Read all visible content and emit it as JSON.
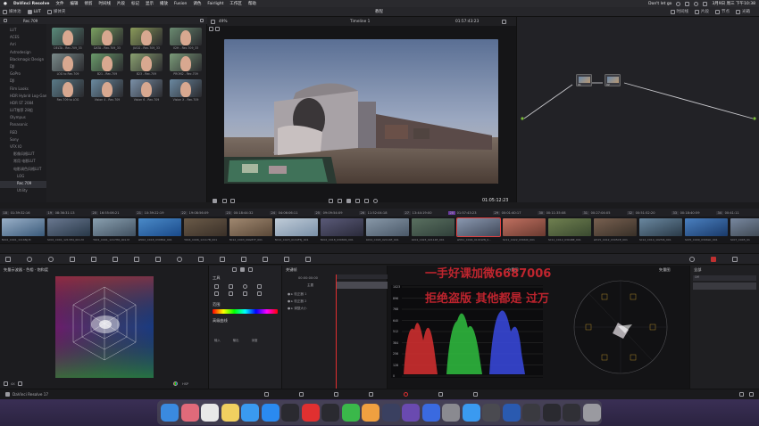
{
  "menubar": {
    "app": "DaVinci Resolve",
    "items": [
      "文件",
      "编辑",
      "修剪",
      "时间线",
      "片段",
      "标记",
      "显示",
      "播放",
      "Fusion",
      "调色",
      "Fairlight",
      "工作区",
      "帮助"
    ],
    "now_playing": "Don't let go",
    "datetime": "3月9日 周三 下午10:38"
  },
  "toolbar": {
    "left": [
      "媒体池",
      "LUT",
      "媒体夹"
    ],
    "project_title": "教程",
    "right": [
      "时间线",
      "片段",
      "节点",
      "光箱"
    ],
    "lightbox": "光箱"
  },
  "lut_panel": {
    "current_folder": "Rec.709",
    "tree": [
      "LUT",
      "ACES",
      "Arri",
      "Astrodesign",
      "Blackmagic Design",
      "DJI",
      "GoPro",
      "DJI",
      "Film Looks",
      "HDR Hybrid Log-Gamma",
      "HDR ST 2084",
      "LUT推荐 28组",
      "Olympus",
      "Panasonic",
      "RED",
      "Sony",
      "VFX IO",
      "影像风格LUT",
      "常用 电影LUT",
      "电影调色风格LUT",
      "LOG",
      "Rec.709",
      "Utility"
    ],
    "selected_tree": "Rec.709",
    "luts": [
      {
        "label": "DELTA - Rec.709_33",
        "tint": "#5a8a7a"
      },
      {
        "label": "DATA - Rec.709_33",
        "tint": "#7aa060"
      },
      {
        "label": "JUGG - Rec.709_33",
        "tint": "#8a9a5a"
      },
      {
        "label": "V2H - Rec.709_33",
        "tint": "#6a8a70"
      },
      {
        "label": "LOG to Rec.709",
        "tint": "#7a8a8a"
      },
      {
        "label": "B21 - Rec.709",
        "tint": "#6a9a6a"
      },
      {
        "label": "B23 - Rec.709",
        "tint": "#8aa070"
      },
      {
        "label": "PROM2 - Rec.709",
        "tint": "#7a9a78"
      },
      {
        "label": "Rec.709 to LOG",
        "tint": "#5a7a88"
      },
      {
        "label": "Vision 4 - Rec.709",
        "tint": "#6a8aa0"
      },
      {
        "label": "Vision 6 - Rec.709",
        "tint": "#7a90a8"
      },
      {
        "label": "Vision X - Rec.709",
        "tint": "#6a88a0"
      }
    ]
  },
  "viewer": {
    "zoom": "49%",
    "timeline_name": "Timeline 1",
    "timecode_top": "01:57:43:23",
    "timecode": "01:05:12:23"
  },
  "nodes": [
    {
      "label": "01"
    },
    {
      "label": "02"
    }
  ],
  "clips": [
    {
      "num": "18",
      "tc": "01:39:32:16",
      "name": "B002_C001_1116NJ.M",
      "c1": "#3a5a7a",
      "c2": "#9ab0c8"
    },
    {
      "num": "19",
      "tc": "08:36:31:13",
      "name": "A002_C001_1213H4_001.M",
      "c1": "#283848",
      "c2": "#6a7890"
    },
    {
      "num": "20",
      "tc": "16:55:06:21",
      "name": "H001_C001_1217H6_001.M",
      "c1": "#405060",
      "c2": "#8aa0b0"
    },
    {
      "num": "21",
      "tc": "10:39:22:19",
      "name": "W002_C018_0308S2_001",
      "c1": "#1a4a8a",
      "c2": "#4a8ac8"
    },
    {
      "num": "22",
      "tc": "19:08:56:09",
      "name": "H004_C006_12117B_001",
      "c1": "#3a3028",
      "c2": "#6a5a48"
    },
    {
      "num": "23",
      "tc": "00:18:44:32",
      "name": "B012_C003_09G8YF_001",
      "c1": "#5a4838",
      "c2": "#a08870"
    },
    {
      "num": "24",
      "tc": "04:06:06:11",
      "name": "B012_C023_0134F5J_001",
      "c1": "#7a90a8",
      "c2": "#c0ccd8"
    },
    {
      "num": "25",
      "tc": "09:09:54:09",
      "name": "B002_C018_03084S_001",
      "c1": "#2a2a3a",
      "c2": "#5a5a78"
    },
    {
      "num": "26",
      "tc": "11:52:04:18",
      "name": "S004_C018_02114E_001",
      "c1": "#4a5868",
      "c2": "#8898a8"
    },
    {
      "num": "27",
      "tc": "13:44:19:00",
      "name": "S004_C023_02114E_001",
      "c1": "#30403a",
      "c2": "#5a7060"
    },
    {
      "num": "28",
      "tc": "01:57:43:23",
      "name": "W051_C004_0101WN_0...",
      "c1": "#404858",
      "c2": "#8a98b0",
      "selected": true
    },
    {
      "num": "29",
      "tc": "00:01:40:17",
      "name": "A011_C022_0306IX_001",
      "c1": "#6a3a30",
      "c2": "#c07060"
    },
    {
      "num": "30",
      "tc": "00:11:35:08",
      "name": "A011_C012_03048E_001",
      "c1": "#3a4a30",
      "c2": "#708050"
    },
    {
      "num": "31",
      "tc": "00:27:04:05",
      "name": "W015_C012_0305CE_001",
      "c1": "#383028",
      "c2": "#786050"
    },
    {
      "num": "32",
      "tc": "00:51:52:20",
      "name": "A014_C014_1025IS_001",
      "c1": "#2a3a48",
      "c2": "#6a88a0"
    },
    {
      "num": "33",
      "tc": "00:18:40:59",
      "name": "A005_C009_0306LK_001",
      "c1": "#1a3a6a",
      "c2": "#4a80c0"
    },
    {
      "num": "34",
      "tc": "00:41:11",
      "name": "A007_C005_01",
      "c1": "#384048",
      "c2": "#7888a0"
    }
  ],
  "vectorscope_panel": {
    "title": "矢量示波器 - 色相 · 饱和度",
    "zoom": "4X",
    "mode": "HSP"
  },
  "control_panel": {
    "title": "工具",
    "section": "范围",
    "section2": "高级曲线",
    "labels": [
      "输入",
      "输出",
      "深度"
    ]
  },
  "keyframe_panel": {
    "title": "关键帧",
    "tc": "00:00:00:00",
    "master": "主要",
    "tracks": [
      "校正器 1",
      "校正器 2",
      "调整大小"
    ]
  },
  "scopes": {
    "title": "分量图",
    "title_vector": "矢量图",
    "scale": [
      "1023",
      "896",
      "768",
      "640",
      "512",
      "384",
      "256",
      "128",
      "0"
    ]
  },
  "right_panel": {
    "title": "全部",
    "item": "Off"
  },
  "watermark": {
    "line1": "一手好课加微6687006",
    "line2": "拒绝盗版 其他都是 过万"
  },
  "pagebar": {
    "app": "DaVinci Resolve 17"
  },
  "dock": [
    {
      "name": "finder-icon",
      "c": "#3a8ae0"
    },
    {
      "name": "launchpad-icon",
      "c": "#e06a7a"
    },
    {
      "name": "chrome-icon",
      "c": "#e8e8e8"
    },
    {
      "name": "notes-icon",
      "c": "#f0d060"
    },
    {
      "name": "safari-icon",
      "c": "#3a9af0"
    },
    {
      "name": "appstore-icon",
      "c": "#2a8af0"
    },
    {
      "name": "finalcut-icon",
      "c": "#2a2a30"
    },
    {
      "name": "netease-music-icon",
      "c": "#e03030"
    },
    {
      "name": "qq-icon",
      "c": "#2a2a30"
    },
    {
      "name": "wechat-icon",
      "c": "#3ab84a"
    },
    {
      "name": "photos-icon",
      "c": "#f0a040"
    },
    {
      "name": "davinci-icon",
      "c": "#3a4060"
    },
    {
      "name": "motion-icon",
      "c": "#6a4ab0"
    },
    {
      "name": "baidu-icon",
      "c": "#3a6ae0"
    },
    {
      "name": "settings-icon",
      "c": "#8a8a90"
    },
    {
      "name": "mail-icon",
      "c": "#3a9af0"
    },
    {
      "name": "screenshot-icon",
      "c": "#4a4a50"
    },
    {
      "name": "word-icon",
      "c": "#2a5ab0"
    },
    {
      "name": "quicktime-icon",
      "c": "#3a3a40"
    },
    {
      "name": "window-thumb-icon",
      "c": "#2a2a30"
    },
    {
      "name": "window-thumb-2-icon",
      "c": "#303036"
    },
    {
      "name": "trash-icon",
      "c": "#9a9aa0"
    }
  ]
}
